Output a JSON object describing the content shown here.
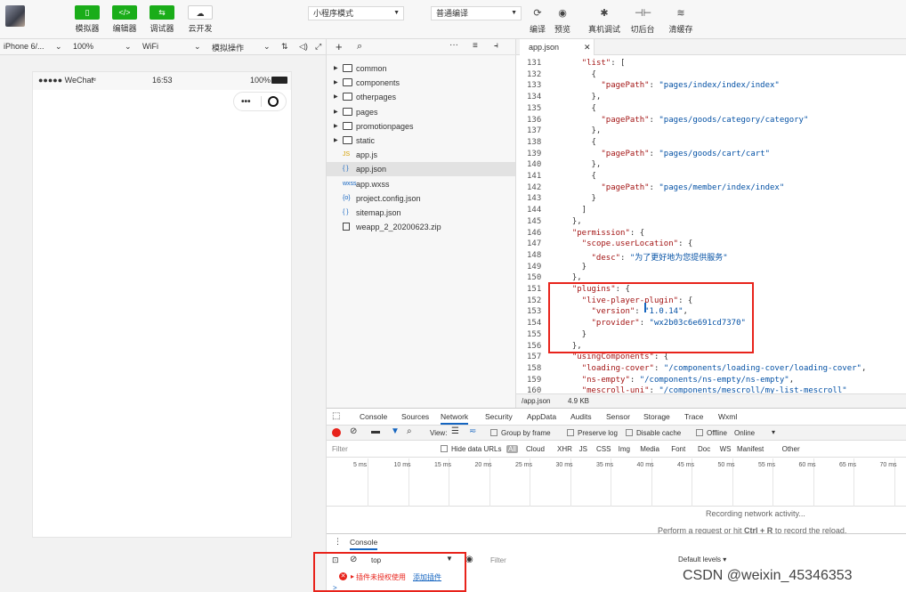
{
  "toolbar": {
    "buttons": [
      {
        "label": "模拟器",
        "glyph": "▯"
      },
      {
        "label": "编辑器",
        "glyph": "</>"
      },
      {
        "label": "调试器",
        "glyph": "⇆"
      },
      {
        "label": "云开发",
        "glyph": "☁"
      }
    ],
    "mode_select": "小程序模式",
    "compile_select": "普通编译",
    "right_buttons": [
      {
        "label": "编译",
        "icon": "refresh-icon",
        "glyph": "⟳"
      },
      {
        "label": "预览",
        "icon": "eye-icon",
        "glyph": "◉"
      },
      {
        "label": "真机调试",
        "icon": "bug-icon",
        "glyph": "✱"
      },
      {
        "label": "切后台",
        "icon": "switch-icon",
        "glyph": "⊣⊢"
      },
      {
        "label": "清缓存",
        "icon": "layers-icon",
        "glyph": "≋"
      }
    ]
  },
  "simulator": {
    "device": "iPhone 6/...",
    "zoom": "100%",
    "network": "WiFi",
    "operation": "模拟操作",
    "status_signal": "●●●●● WeChat",
    "status_time": "16:53",
    "status_battery": "100%"
  },
  "file_tree": {
    "items": [
      {
        "name": "common",
        "type": "folder"
      },
      {
        "name": "components",
        "type": "folder"
      },
      {
        "name": "otherpages",
        "type": "folder"
      },
      {
        "name": "pages",
        "type": "folder"
      },
      {
        "name": "promotionpages",
        "type": "folder"
      },
      {
        "name": "static",
        "type": "folder"
      },
      {
        "name": "app.js",
        "type": "js",
        "glyph": "JS"
      },
      {
        "name": "app.json",
        "type": "json",
        "glyph": "{ }"
      },
      {
        "name": "app.wxss",
        "type": "wxss",
        "glyph": "wxss"
      },
      {
        "name": "project.config.json",
        "type": "config",
        "glyph": "{o}"
      },
      {
        "name": "sitemap.json",
        "type": "json",
        "glyph": "{ }"
      },
      {
        "name": "weapp_2_20200623.zip",
        "type": "file",
        "glyph": ""
      }
    ]
  },
  "editor": {
    "tab": "app.json",
    "lines": [
      {
        "n": "131",
        "t": "    \"list\": ["
      },
      {
        "n": "132",
        "t": "      {"
      },
      {
        "n": "133",
        "t": "        \"pagePath\": \"pages/index/index/index\""
      },
      {
        "n": "134",
        "t": "      },"
      },
      {
        "n": "135",
        "t": "      {"
      },
      {
        "n": "136",
        "t": "        \"pagePath\": \"pages/goods/category/category\""
      },
      {
        "n": "137",
        "t": "      },"
      },
      {
        "n": "138",
        "t": "      {"
      },
      {
        "n": "139",
        "t": "        \"pagePath\": \"pages/goods/cart/cart\""
      },
      {
        "n": "140",
        "t": "      },"
      },
      {
        "n": "141",
        "t": "      {"
      },
      {
        "n": "142",
        "t": "        \"pagePath\": \"pages/member/index/index\""
      },
      {
        "n": "143",
        "t": "      }"
      },
      {
        "n": "144",
        "t": "    ]"
      },
      {
        "n": "145",
        "t": "  },"
      },
      {
        "n": "146",
        "t": "  \"permission\": {"
      },
      {
        "n": "147",
        "t": "    \"scope.userLocation\": {"
      },
      {
        "n": "148",
        "t": "      \"desc\": \"为了更好地为您提供服务\""
      },
      {
        "n": "149",
        "t": "    }"
      },
      {
        "n": "150",
        "t": "  },"
      },
      {
        "n": "151",
        "t": "  \"plugins\": {"
      },
      {
        "n": "152",
        "t": "    \"live-player-plugin\": {"
      },
      {
        "n": "153",
        "t": "      \"version\": \"1.0.14\","
      },
      {
        "n": "154",
        "t": "      \"provider\": \"wx2b03c6e691cd7370\""
      },
      {
        "n": "155",
        "t": "    }"
      },
      {
        "n": "156",
        "t": "  },"
      },
      {
        "n": "157",
        "t": "  \"usingComponents\": {"
      },
      {
        "n": "158",
        "t": "    \"loading-cover\": \"/components/loading-cover/loading-cover\","
      },
      {
        "n": "159",
        "t": "    \"ns-empty\": \"/components/ns-empty/ns-empty\","
      },
      {
        "n": "160",
        "t": "    \"mescroll-uni\": \"/components/mescroll/my-list-mescroll\""
      }
    ],
    "status_path": "/app.json",
    "status_size": "4.9 KB"
  },
  "devtools": {
    "tabs": [
      "Console",
      "Sources",
      "Network",
      "Security",
      "AppData",
      "Audits",
      "Sensor",
      "Storage",
      "Trace",
      "Wxml"
    ],
    "active_tab": "Network",
    "net_view": "View:",
    "group_by_frame": "Group by frame",
    "preserve_log": "Preserve log",
    "disable_cache": "Disable cache",
    "offline": "Offline",
    "online": "Online",
    "filter_placeholder": "Filter",
    "hide_data_urls": "Hide data URLs",
    "types": [
      "All",
      "Cloud",
      "XHR",
      "JS",
      "CSS",
      "Img",
      "Media",
      "Font",
      "Doc",
      "WS",
      "Manifest",
      "Other"
    ],
    "ticks": [
      "5 ms",
      "10 ms",
      "15 ms",
      "20 ms",
      "25 ms",
      "30 ms",
      "35 ms",
      "40 ms",
      "45 ms",
      "50 ms",
      "55 ms",
      "60 ms",
      "65 ms",
      "70 ms"
    ],
    "recording": "Recording network activity...",
    "hint_pre": "Perform a request or hit ",
    "hint_key": "Ctrl + R",
    "hint_post": " to record the reload."
  },
  "console": {
    "tab": "Console",
    "context": "top",
    "filter_placeholder": "Filter",
    "levels": "Default levels ▾",
    "error_text": "插件未授权使用",
    "error_link": "添加插件",
    "prompt": ">"
  },
  "watermark": "CSDN @weixin_45346353",
  "colors": {
    "accent_green": "#1aad19",
    "highlight_red": "#e8231b",
    "string_blue": "#0451a5",
    "key_red": "#a31515"
  }
}
